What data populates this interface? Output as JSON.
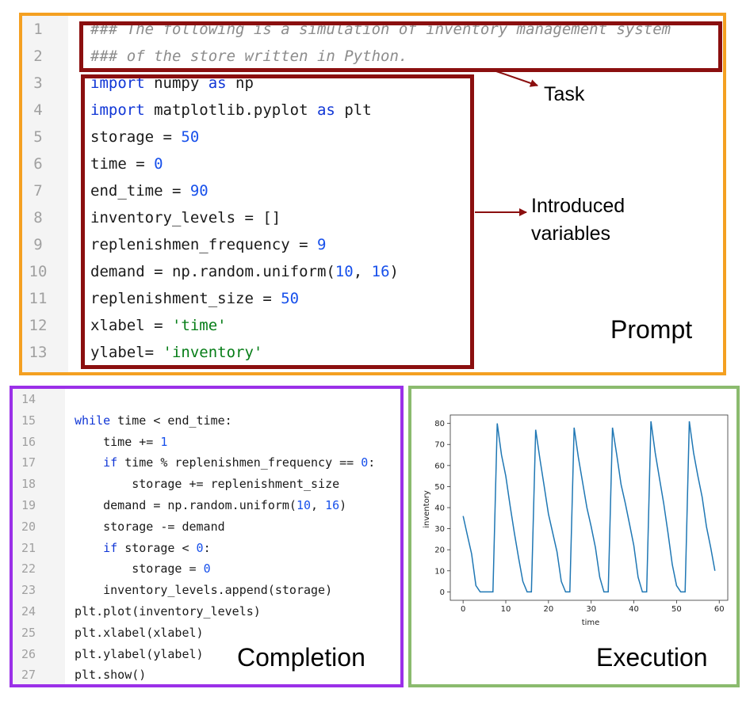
{
  "prompt": {
    "label": "Prompt",
    "lines": [
      {
        "n": "1",
        "tokens": [
          {
            "t": "### The following is a simulation of inventory management system",
            "c": "com"
          }
        ]
      },
      {
        "n": "2",
        "tokens": [
          {
            "t": "### of the store written in Python.",
            "c": "com"
          }
        ]
      },
      {
        "n": "3",
        "tokens": [
          {
            "t": "import",
            "c": "kw"
          },
          {
            "t": " numpy "
          },
          {
            "t": "as",
            "c": "kw"
          },
          {
            "t": " np"
          }
        ]
      },
      {
        "n": "4",
        "tokens": [
          {
            "t": "import",
            "c": "kw"
          },
          {
            "t": " matplotlib.pyplot "
          },
          {
            "t": "as",
            "c": "kw"
          },
          {
            "t": " plt"
          }
        ]
      },
      {
        "n": "5",
        "tokens": [
          {
            "t": "storage = "
          },
          {
            "t": "50",
            "c": "num"
          }
        ]
      },
      {
        "n": "6",
        "tokens": [
          {
            "t": "time = "
          },
          {
            "t": "0",
            "c": "num"
          }
        ]
      },
      {
        "n": "7",
        "tokens": [
          {
            "t": "end_time = "
          },
          {
            "t": "90",
            "c": "num"
          }
        ]
      },
      {
        "n": "8",
        "tokens": [
          {
            "t": "inventory_levels = []"
          }
        ]
      },
      {
        "n": "9",
        "tokens": [
          {
            "t": "replenishmen_frequency = "
          },
          {
            "t": "9",
            "c": "num"
          }
        ]
      },
      {
        "n": "10",
        "tokens": [
          {
            "t": "demand = np.random.uniform("
          },
          {
            "t": "10",
            "c": "num"
          },
          {
            "t": ", "
          },
          {
            "t": "16",
            "c": "num"
          },
          {
            "t": ")"
          }
        ]
      },
      {
        "n": "11",
        "tokens": [
          {
            "t": "replenishment_size = "
          },
          {
            "t": "50",
            "c": "num"
          }
        ]
      },
      {
        "n": "12",
        "tokens": [
          {
            "t": "xlabel = "
          },
          {
            "t": "'time'",
            "c": "str"
          }
        ]
      },
      {
        "n": "13",
        "tokens": [
          {
            "t": "ylabel= "
          },
          {
            "t": "'inventory'",
            "c": "str"
          }
        ]
      }
    ]
  },
  "annotations": {
    "task": "Task",
    "introduced_variables": [
      "Introduced",
      "variables"
    ]
  },
  "completion": {
    "label": "Completion",
    "lines": [
      {
        "n": "14",
        "tokens": []
      },
      {
        "n": "15",
        "tokens": [
          {
            "t": "while",
            "c": "kw"
          },
          {
            "t": " time < end_time:"
          }
        ]
      },
      {
        "n": "16",
        "tokens": [
          {
            "t": "    time += "
          },
          {
            "t": "1",
            "c": "num"
          }
        ]
      },
      {
        "n": "17",
        "tokens": [
          {
            "t": "    "
          },
          {
            "t": "if",
            "c": "kw"
          },
          {
            "t": " time % replenishmen_frequency == "
          },
          {
            "t": "0",
            "c": "num"
          },
          {
            "t": ":"
          }
        ]
      },
      {
        "n": "18",
        "tokens": [
          {
            "t": "        storage += replenishment_size"
          }
        ]
      },
      {
        "n": "19",
        "tokens": [
          {
            "t": "    demand = np.random.uniform("
          },
          {
            "t": "10",
            "c": "num"
          },
          {
            "t": ", "
          },
          {
            "t": "16",
            "c": "num"
          },
          {
            "t": ")"
          }
        ]
      },
      {
        "n": "20",
        "tokens": [
          {
            "t": "    storage -= demand"
          }
        ]
      },
      {
        "n": "21",
        "tokens": [
          {
            "t": "    "
          },
          {
            "t": "if",
            "c": "kw"
          },
          {
            "t": " storage < "
          },
          {
            "t": "0",
            "c": "num"
          },
          {
            "t": ":"
          }
        ]
      },
      {
        "n": "22",
        "tokens": [
          {
            "t": "        storage = "
          },
          {
            "t": "0",
            "c": "num"
          }
        ]
      },
      {
        "n": "23",
        "tokens": [
          {
            "t": "    inventory_levels.append(storage)"
          }
        ]
      },
      {
        "n": "24",
        "tokens": [
          {
            "t": "plt.plot(inventory_levels)"
          }
        ]
      },
      {
        "n": "25",
        "tokens": [
          {
            "t": "plt.xlabel(xlabel)"
          }
        ]
      },
      {
        "n": "26",
        "tokens": [
          {
            "t": "plt.ylabel(ylabel)"
          }
        ]
      },
      {
        "n": "27",
        "tokens": [
          {
            "t": "plt.show()"
          }
        ]
      }
    ]
  },
  "execution": {
    "label": "Execution"
  },
  "colors": {
    "prompt_frame": "#f4a021",
    "completion_frame": "#9b30e8",
    "execution_frame": "#8bbb6e",
    "annotation": "#8b0f0f",
    "series_line": "#1f77b4"
  },
  "chart_data": {
    "type": "line",
    "title": "",
    "xlabel": "time",
    "ylabel": "inventory",
    "xlim": [
      -3,
      62
    ],
    "ylim": [
      -4,
      84
    ],
    "xticks": [
      0,
      10,
      20,
      30,
      40,
      50,
      60
    ],
    "yticks": [
      0,
      10,
      20,
      30,
      40,
      50,
      60,
      70,
      80
    ],
    "grid": false,
    "series": [
      {
        "name": "",
        "x": [
          0,
          1,
          2,
          3,
          4,
          5,
          6,
          7,
          8,
          9,
          10,
          11,
          12,
          13,
          14,
          15,
          16,
          17,
          18,
          19,
          20,
          21,
          22,
          23,
          24,
          25,
          26,
          27,
          28,
          29,
          30,
          31,
          32,
          33,
          34,
          35,
          36,
          37,
          38,
          39,
          40,
          41,
          42,
          43,
          44,
          45,
          46,
          47,
          48,
          49,
          50,
          51,
          52,
          53,
          54,
          55,
          56,
          57,
          58,
          59
        ],
        "values": [
          36,
          27,
          18,
          3,
          0,
          0,
          0,
          0,
          80,
          65,
          55,
          41,
          28,
          16,
          5,
          0,
          0,
          77,
          63,
          50,
          37,
          28,
          19,
          5,
          0,
          0,
          78,
          64,
          52,
          40,
          31,
          21,
          7,
          0,
          0,
          78,
          65,
          51,
          42,
          32,
          22,
          7,
          0,
          0,
          81,
          66,
          54,
          42,
          28,
          13,
          3,
          0,
          0,
          81,
          66,
          55,
          45,
          31,
          21,
          10
        ]
      }
    ]
  }
}
